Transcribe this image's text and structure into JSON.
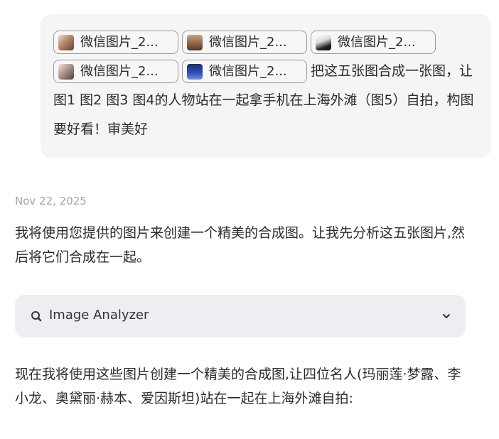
{
  "user_message": {
    "attachments": [
      {
        "name": "微信图片_2..."
      },
      {
        "name": "微信图片_2..."
      },
      {
        "name": "微信图片_2..."
      },
      {
        "name": "微信图片_2..."
      },
      {
        "name": "微信图片_2..."
      }
    ],
    "text": "把这五张图合成一张图，让图1 图2 图3 图4的人物站在一起拿手机在上海外滩（图5）自拍，构图要好看！审美好"
  },
  "timestamp": "Nov 22, 2025",
  "assistant": {
    "paragraph_1": "我将使用您提供的图片来创建一个精美的合成图。让我先分析这五张图片,然后将它们合成在一起。",
    "tool": {
      "name": "Image Analyzer",
      "icon": "search-icon",
      "toggle_icon": "chevron-down-icon"
    },
    "paragraph_2": "现在我将使用这些图片创建一个精美的合成图,让四位名人(玛丽莲·梦露、李小龙、奥黛丽·赫本、爱因斯坦)站在一起在上海外滩自拍:"
  }
}
